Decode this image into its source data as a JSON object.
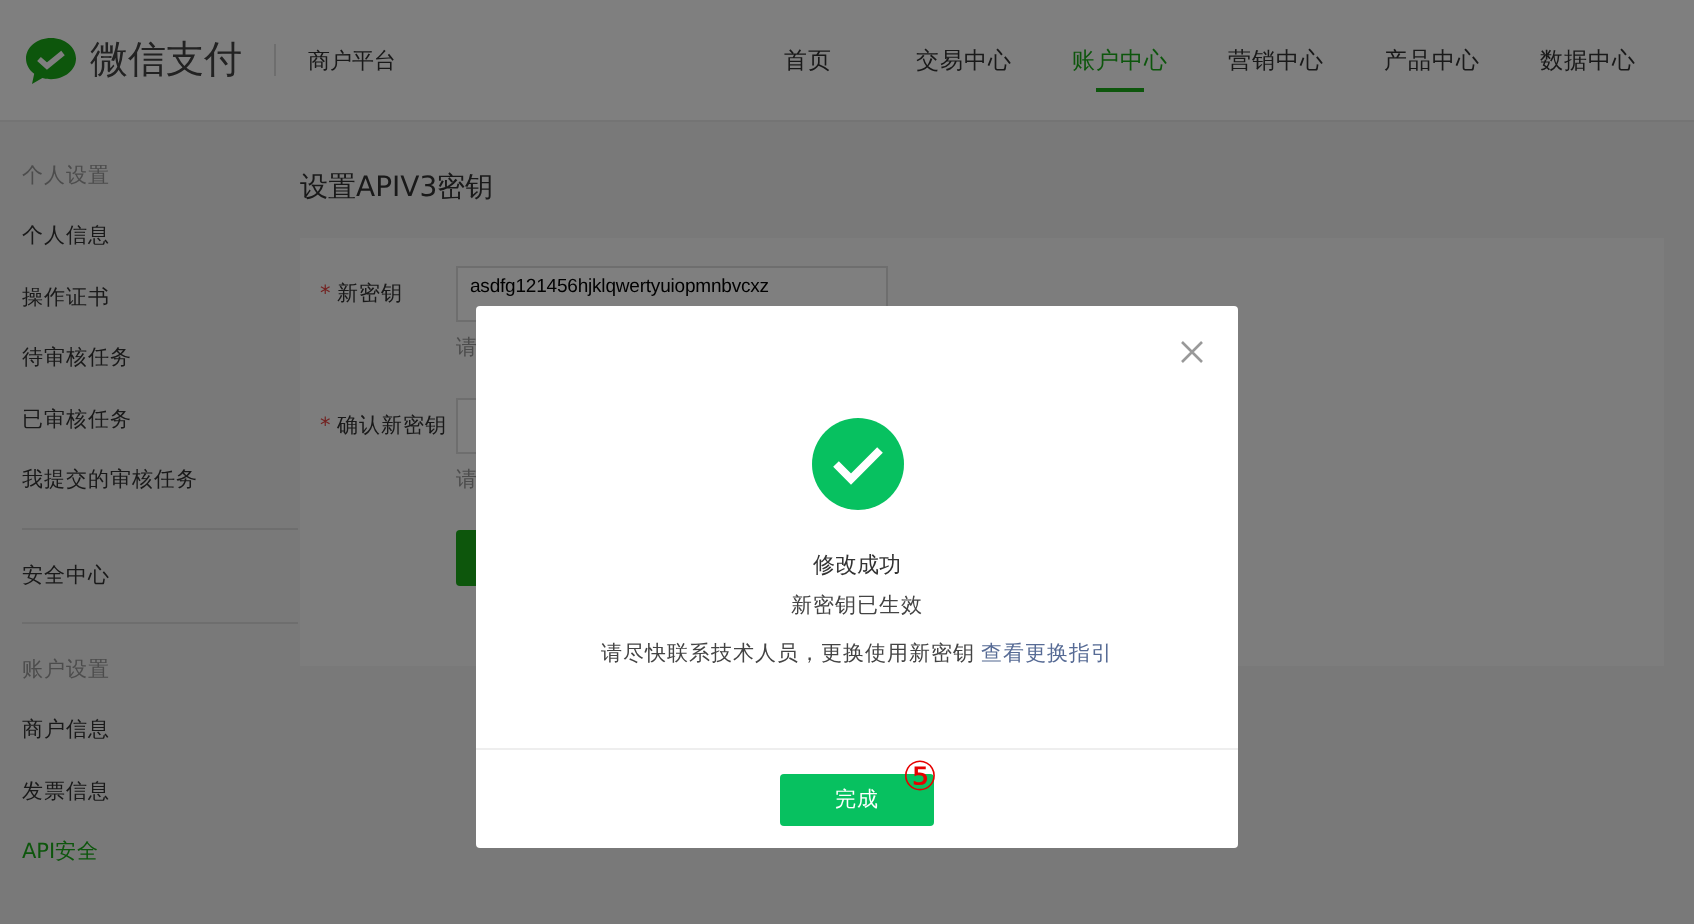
{
  "header": {
    "brand": "微信支付",
    "platform": "商户平台",
    "nav": [
      {
        "label": "首页",
        "selected": false
      },
      {
        "label": "交易中心",
        "selected": false
      },
      {
        "label": "账户中心",
        "selected": true
      },
      {
        "label": "营销中心",
        "selected": false
      },
      {
        "label": "产品中心",
        "selected": false
      },
      {
        "label": "数据中心",
        "selected": false
      }
    ]
  },
  "sidebar": {
    "sections": [
      {
        "heading": "个人设置",
        "items": [
          {
            "label": "个人信息",
            "selected": false
          },
          {
            "label": "操作证书",
            "selected": false
          },
          {
            "label": "待审核任务",
            "selected": false
          },
          {
            "label": "已审核任务",
            "selected": false
          },
          {
            "label": "我提交的审核任务",
            "selected": false
          }
        ]
      },
      {
        "items": [
          {
            "label": "安全中心",
            "selected": false
          }
        ]
      },
      {
        "heading": "账户设置",
        "items": [
          {
            "label": "商户信息",
            "selected": false
          },
          {
            "label": "发票信息",
            "selected": false
          },
          {
            "label": "API安全",
            "selected": true
          }
        ]
      }
    ]
  },
  "page_title": "设置APIV3密钥",
  "form": {
    "fields": [
      {
        "label": "新密钥",
        "required_mark": "*",
        "value": "asdfg121456hjklqwertyuiopmnbvcxz",
        "hint": "请"
      },
      {
        "label": "确认新密钥",
        "required_mark": "*",
        "hint": "请"
      }
    ]
  },
  "dialog": {
    "title": "修改成功",
    "subtitle": "新密钥已生效",
    "message": "请尽快联系技术人员，更换使用新密钥",
    "link": "查看更换指引",
    "button": "完成",
    "step_marker": "⑤"
  }
}
